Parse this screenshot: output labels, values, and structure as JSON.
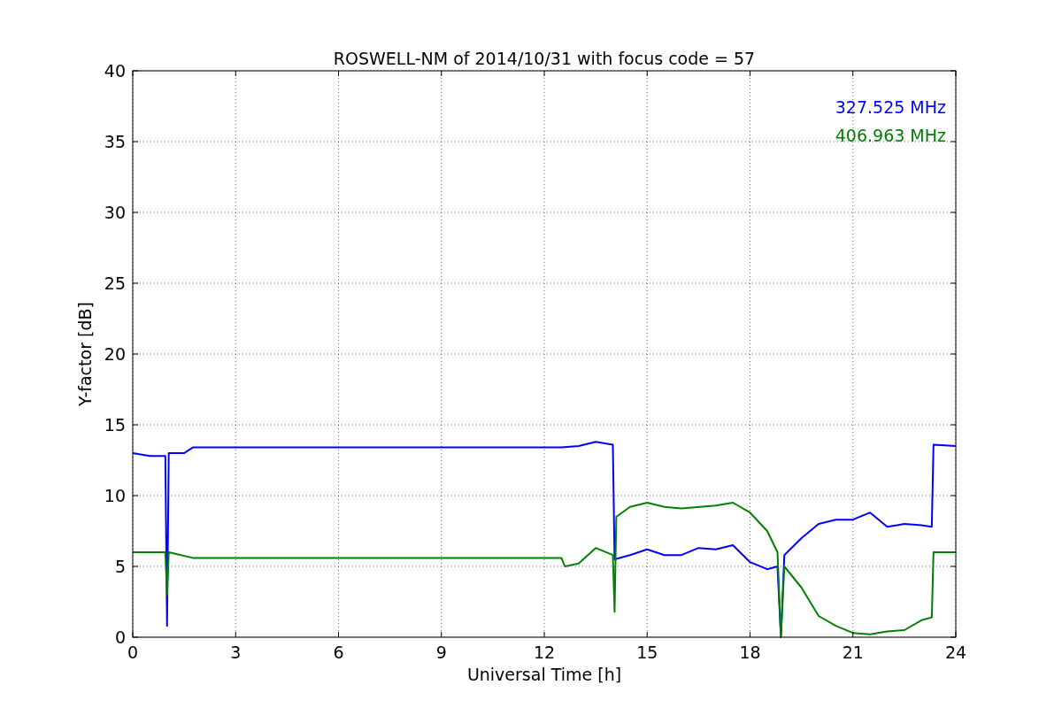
{
  "chart_data": {
    "type": "line",
    "title": "ROSWELL-NM of 2014/10/31 with focus code = 57",
    "xlabel": "Universal Time [h]",
    "ylabel": "Y-factor [dB]",
    "xlim": [
      0,
      24
    ],
    "ylim": [
      0,
      40
    ],
    "xticks": [
      0,
      3,
      6,
      9,
      12,
      15,
      18,
      21,
      24
    ],
    "yticks": [
      0,
      5,
      10,
      15,
      20,
      25,
      30,
      35,
      40
    ],
    "grid": true,
    "series": [
      {
        "name": "327.525 MHz",
        "color": "#0000ff",
        "x": [
          0,
          0.5,
          0.95,
          1.0,
          1.05,
          1.5,
          1.75,
          12.5,
          13,
          13.5,
          14,
          14.05,
          14.5,
          15,
          15.5,
          16,
          16.5,
          17,
          17.5,
          18,
          18.5,
          18.8,
          18.9,
          19,
          19.5,
          20,
          20.5,
          21,
          21.5,
          22,
          22.5,
          23,
          23.3,
          23.35,
          24
        ],
        "values": [
          13,
          12.8,
          12.8,
          0.8,
          13,
          13,
          13.4,
          13.4,
          13.5,
          13.8,
          13.6,
          5.5,
          5.8,
          6.2,
          5.8,
          5.8,
          6.3,
          6.2,
          6.5,
          5.3,
          4.8,
          5,
          0,
          5.8,
          7,
          8,
          8.3,
          8.3,
          8.8,
          7.8,
          8,
          7.9,
          7.8,
          13.6,
          13.5
        ]
      },
      {
        "name": "406.963 MHz",
        "color": "#008000",
        "x": [
          0,
          0.95,
          1.0,
          1.05,
          1.75,
          12.5,
          12.6,
          13,
          13.5,
          14,
          14.05,
          14.1,
          14.5,
          15,
          15.5,
          16,
          17,
          17.5,
          18,
          18.5,
          18.8,
          18.9,
          19,
          19.5,
          20,
          20.5,
          21,
          21.5,
          22,
          22.5,
          23,
          23.3,
          23.35,
          24
        ],
        "values": [
          6,
          6,
          3,
          6,
          5.6,
          5.6,
          5,
          5.2,
          6.3,
          5.8,
          1.8,
          8.5,
          9.2,
          9.5,
          9.2,
          9.1,
          9.3,
          9.5,
          8.8,
          7.5,
          6,
          0,
          5,
          3.5,
          1.5,
          0.8,
          0.3,
          0.2,
          0.4,
          0.5,
          1.2,
          1.4,
          6,
          6
        ]
      }
    ]
  }
}
